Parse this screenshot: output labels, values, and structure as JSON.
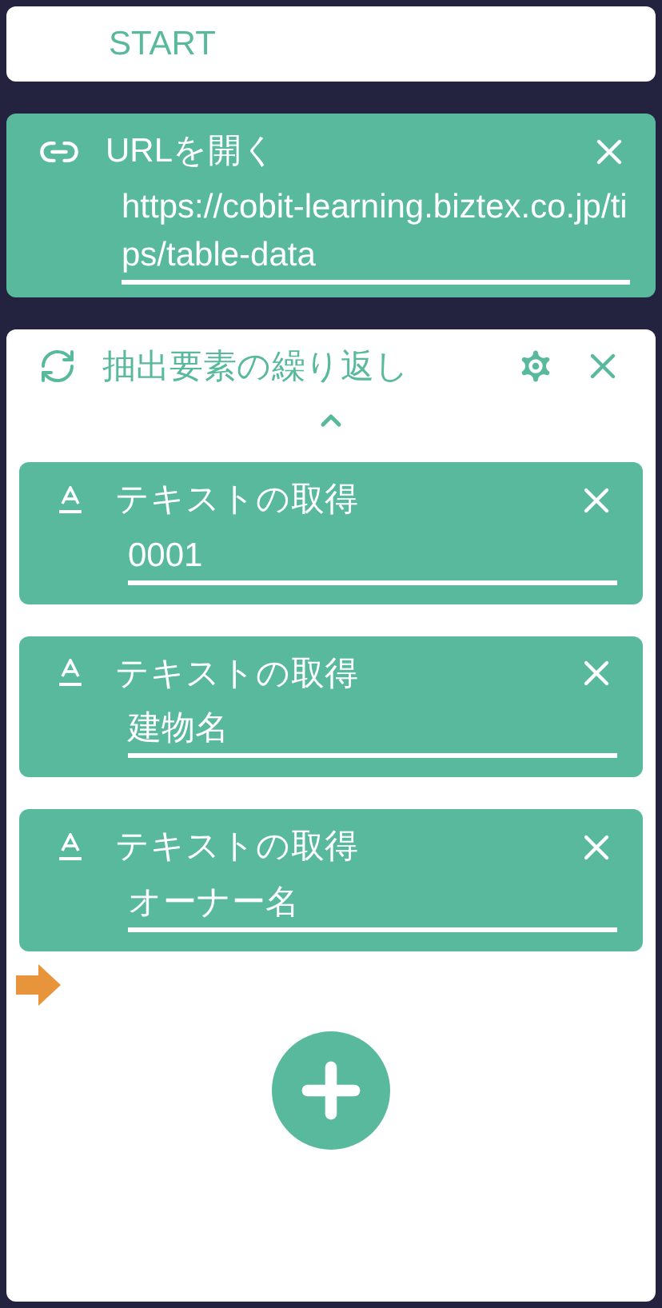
{
  "start": {
    "label": "START"
  },
  "open_url": {
    "title": "URLを開く",
    "value": "https://cobit-learning.biztex.co.jp/tips/table-data"
  },
  "loop": {
    "title": "抽出要素の繰り返し",
    "expanded": true,
    "steps": [
      {
        "title": "テキストの取得",
        "value": "0001"
      },
      {
        "title": "テキストの取得",
        "value": "建物名"
      },
      {
        "title": "テキストの取得",
        "value": "オーナー名"
      }
    ]
  }
}
